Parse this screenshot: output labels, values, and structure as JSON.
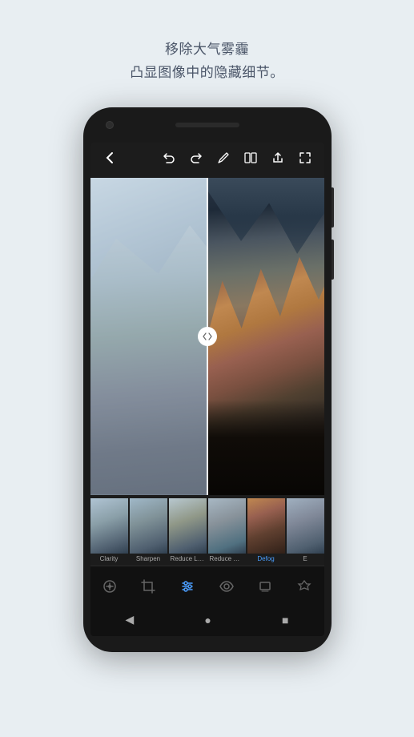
{
  "page": {
    "background_color": "#e8eef2"
  },
  "top_text": {
    "line1": "移除大气雾霾",
    "line2": "凸显图像中的隐藏细节。"
  },
  "toolbar": {
    "back_icon": "←",
    "undo_icon": "↩",
    "redo_icon": "↪",
    "edit_icon": "✏",
    "compare_icon": "⬛",
    "share_icon": "⬆",
    "fullscreen_icon": "⛶"
  },
  "thumbnails": [
    {
      "label": "Clarity",
      "active": false,
      "warm": false
    },
    {
      "label": "Sharpen",
      "active": false,
      "warm": false
    },
    {
      "label": "Reduce Lumi..",
      "active": false,
      "warm": false
    },
    {
      "label": "Reduce Colo..",
      "active": false,
      "warm": false
    },
    {
      "label": "Defog",
      "active": true,
      "warm": true
    },
    {
      "label": "E",
      "active": false,
      "warm": false
    }
  ],
  "bottom_nav": [
    {
      "name": "auto-icon",
      "active": false
    },
    {
      "name": "crop-icon",
      "active": false
    },
    {
      "name": "adjust-icon",
      "active": true
    },
    {
      "name": "eye-icon",
      "active": false
    },
    {
      "name": "layers-icon",
      "active": false
    },
    {
      "name": "healing-icon",
      "active": false
    }
  ],
  "system_nav": {
    "back": "◀",
    "home": "●",
    "recent": "■"
  }
}
